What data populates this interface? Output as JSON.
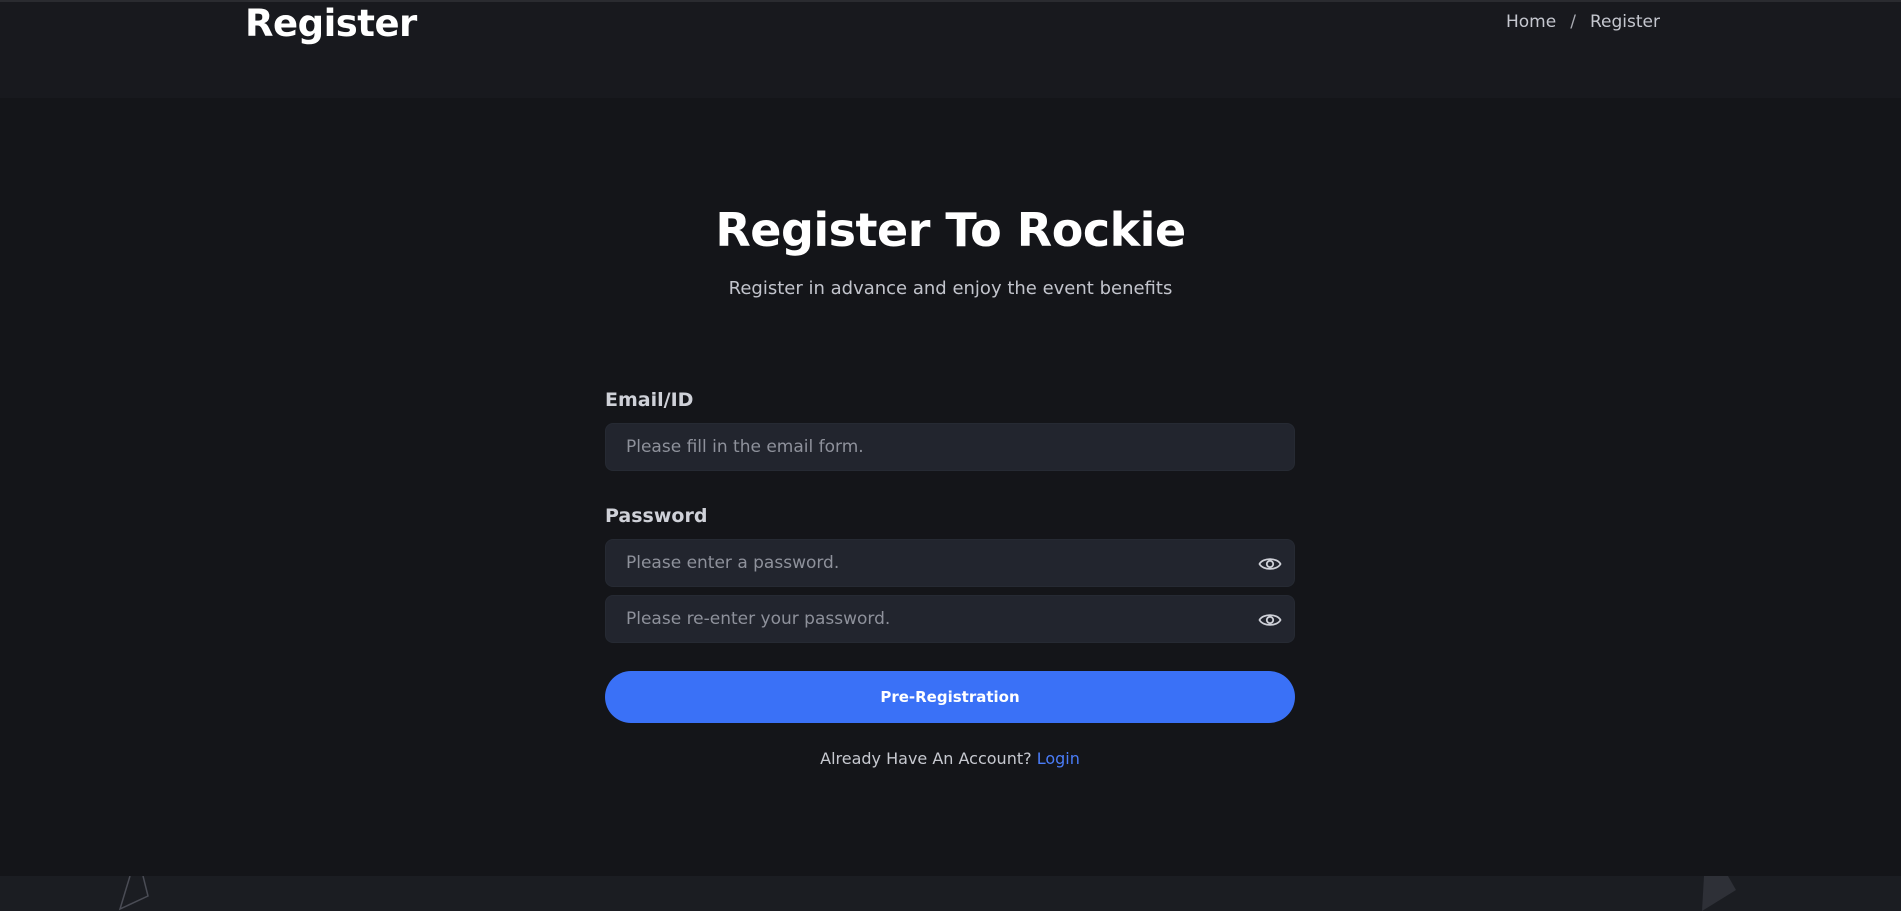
{
  "header": {
    "title": "Register",
    "breadcrumb": {
      "home": "Home",
      "separator": "/",
      "current": "Register"
    }
  },
  "hero": {
    "title": "Register To Rockie",
    "subtitle": "Register in advance and enjoy the event benefits"
  },
  "form": {
    "email": {
      "label": "Email/ID",
      "placeholder": "Please fill in the email form.",
      "value": ""
    },
    "password": {
      "label": "Password",
      "placeholder": "Please enter a password.",
      "value": "",
      "icon": "eye-icon"
    },
    "password_confirm": {
      "placeholder": "Please re-enter your password.",
      "value": "",
      "icon": "eye-icon"
    },
    "submit_label": "Pre-Registration"
  },
  "login": {
    "prompt": "Already Have An Account?",
    "link_label": "Login"
  },
  "colors": {
    "background": "#141519",
    "header_background": "#18191e",
    "input_background": "#22252e",
    "accent": "#3a71f7",
    "link": "#4a7cf7"
  }
}
